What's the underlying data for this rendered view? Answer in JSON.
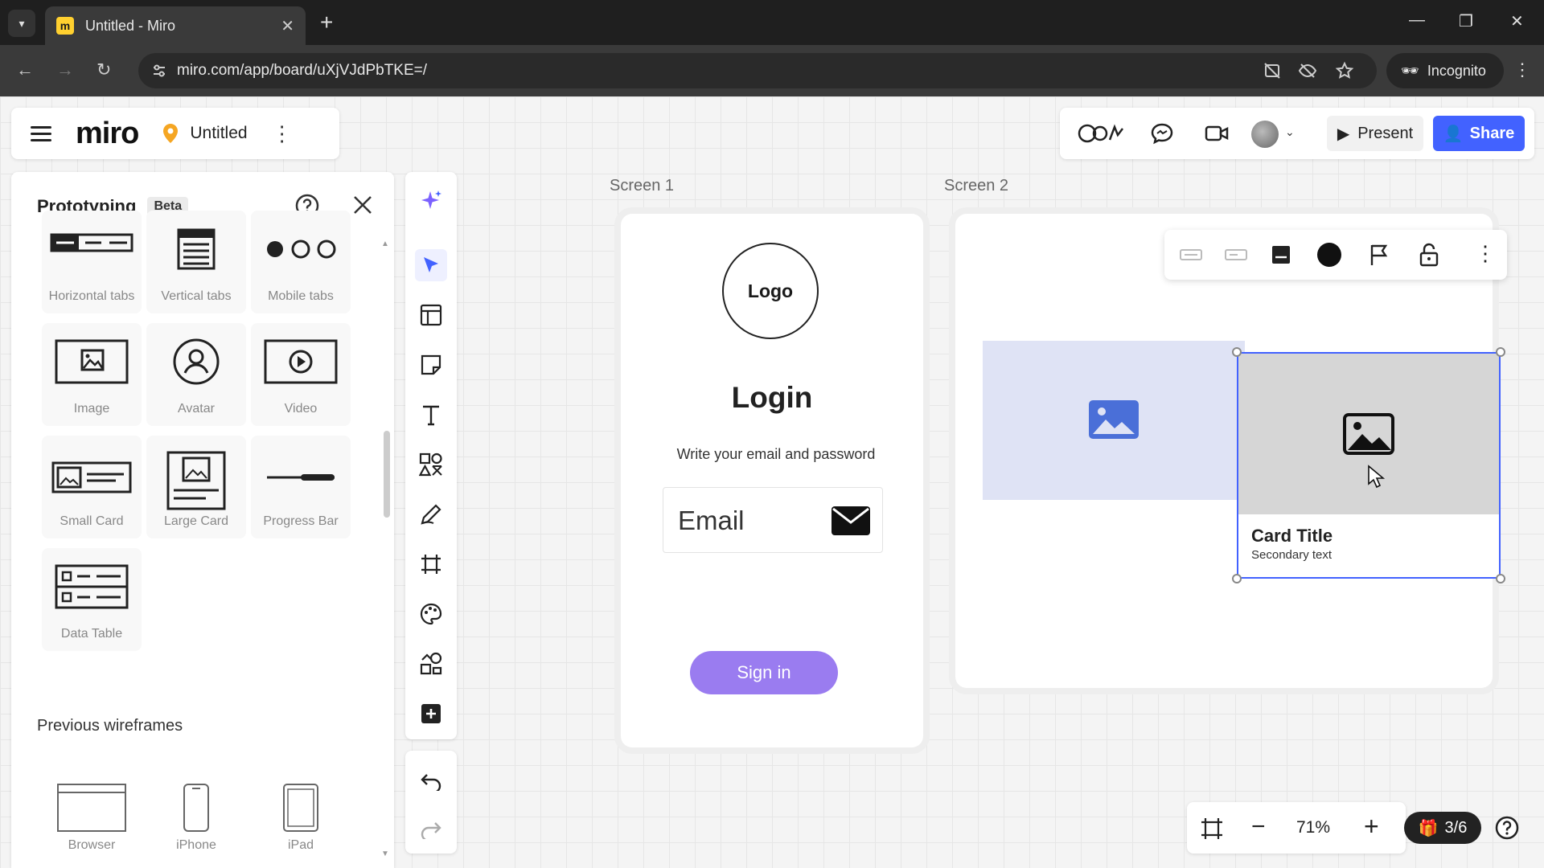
{
  "browser": {
    "tab_title": "Untitled - Miro",
    "url": "miro.com/app/board/uXjVJdPbTKE=/",
    "incognito_label": "Incognito"
  },
  "board": {
    "logo_text": "miro",
    "title": "Untitled"
  },
  "header_actions": {
    "present_label": "Present",
    "share_label": "Share"
  },
  "panel": {
    "title": "Prototyping",
    "badge": "Beta",
    "items": [
      {
        "label": "Horizontal tabs",
        "icon": "horizontal-tabs-icon"
      },
      {
        "label": "Vertical tabs",
        "icon": "vertical-tabs-icon"
      },
      {
        "label": "Mobile tabs",
        "icon": "mobile-tabs-icon"
      },
      {
        "label": "Image",
        "icon": "image-icon"
      },
      {
        "label": "Avatar",
        "icon": "avatar-icon"
      },
      {
        "label": "Video",
        "icon": "video-icon"
      },
      {
        "label": "Small Card",
        "icon": "small-card-icon"
      },
      {
        "label": "Large Card",
        "icon": "large-card-icon"
      },
      {
        "label": "Progress Bar",
        "icon": "progress-bar-icon"
      },
      {
        "label": "Data Table",
        "icon": "data-table-icon"
      }
    ],
    "previous_title": "Previous wireframes",
    "previous_items": [
      {
        "label": "Browser"
      },
      {
        "label": "iPhone"
      },
      {
        "label": "iPad"
      }
    ]
  },
  "screen1": {
    "label": "Screen 1",
    "logo_text": "Logo",
    "heading": "Login",
    "subtitle": "Write your email and password",
    "email_placeholder": "Email",
    "signin_label": "Sign in"
  },
  "screen2": {
    "label": "Screen 2",
    "card_title": "Card Title",
    "card_secondary": "Secondary text"
  },
  "zoom": {
    "level": "71%",
    "pages": "3/6"
  },
  "colors": {
    "accent": "#4262ff",
    "signin": "#9a7cf0",
    "image_placeholder": "#dfe3f5",
    "image_icon": "#4a6fd8"
  }
}
